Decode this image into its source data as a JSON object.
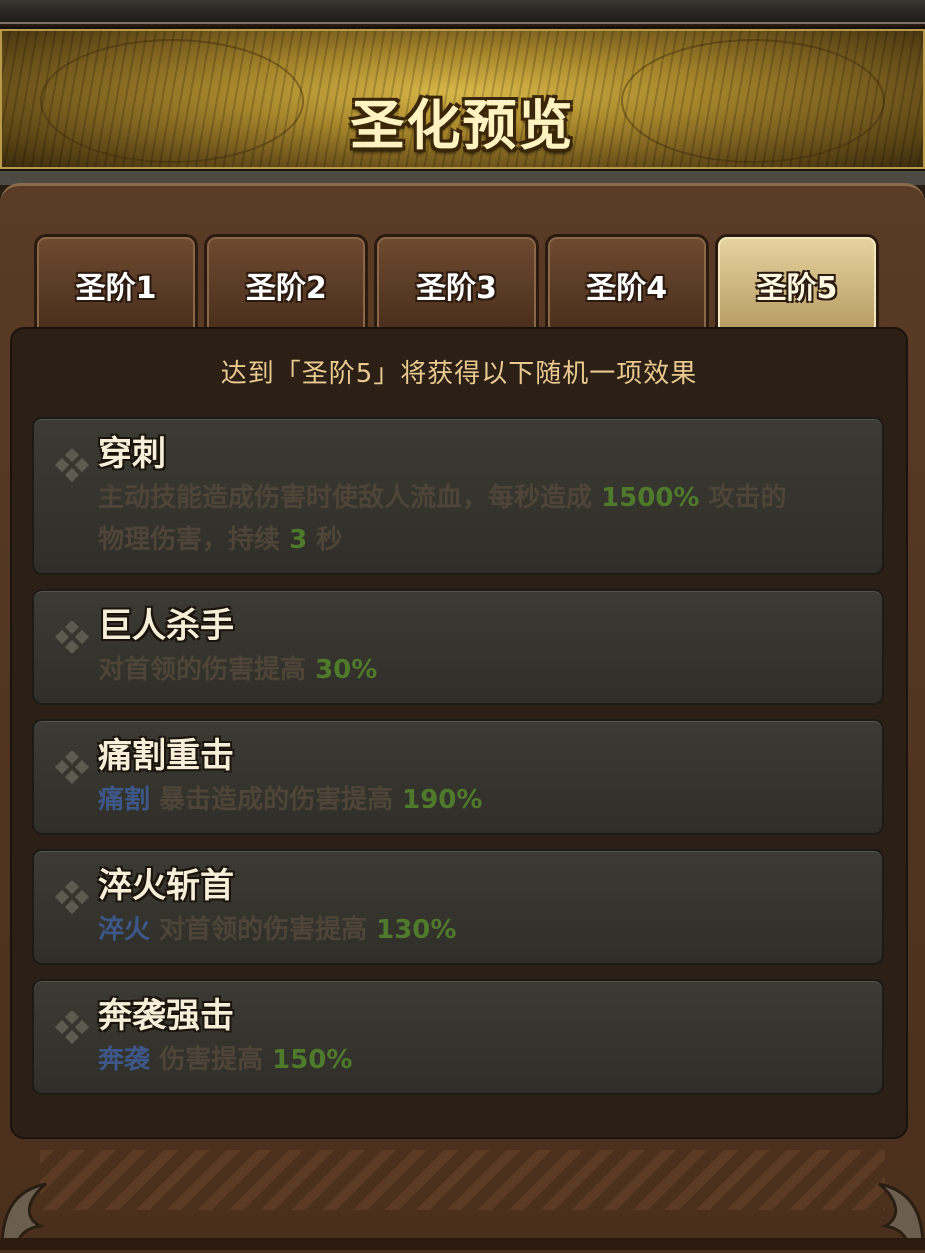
{
  "header": {
    "title": "圣化预览"
  },
  "tabs": [
    {
      "label": "圣阶1",
      "active": false
    },
    {
      "label": "圣阶2",
      "active": false
    },
    {
      "label": "圣阶3",
      "active": false
    },
    {
      "label": "圣阶4",
      "active": false
    },
    {
      "label": "圣阶5",
      "active": true
    }
  ],
  "subtitle": "达到「圣阶5」将获得以下随机一项效果",
  "effects": [
    {
      "name": "穿刺",
      "desc_line1_a": "主动技能造成伤害时使敌人流血，每秒造成 ",
      "desc_line1_value": "1500%",
      "desc_line1_b": " 攻击的",
      "desc_line2_a": "物理伤害，持续 ",
      "desc_line2_value": "3",
      "desc_line2_b": " 秒"
    },
    {
      "name": "巨人杀手",
      "desc_a": "对首领的伤害提高 ",
      "desc_value": "30%"
    },
    {
      "name": "痛割重击",
      "tag": "痛割",
      "desc_a": " 暴击造成的伤害提高 ",
      "desc_value": "190%"
    },
    {
      "name": "淬火斩首",
      "tag": "淬火",
      "desc_a": " 对首领的伤害提高 ",
      "desc_value": "130%"
    },
    {
      "name": "奔袭强击",
      "tag": "奔袭",
      "desc_a": " 伤害提高 ",
      "desc_value": "150%"
    }
  ],
  "colors": {
    "highlight_value": "#4f7a2b",
    "keyword_tag": "#3d5888",
    "subtitle": "#e9c98f"
  }
}
